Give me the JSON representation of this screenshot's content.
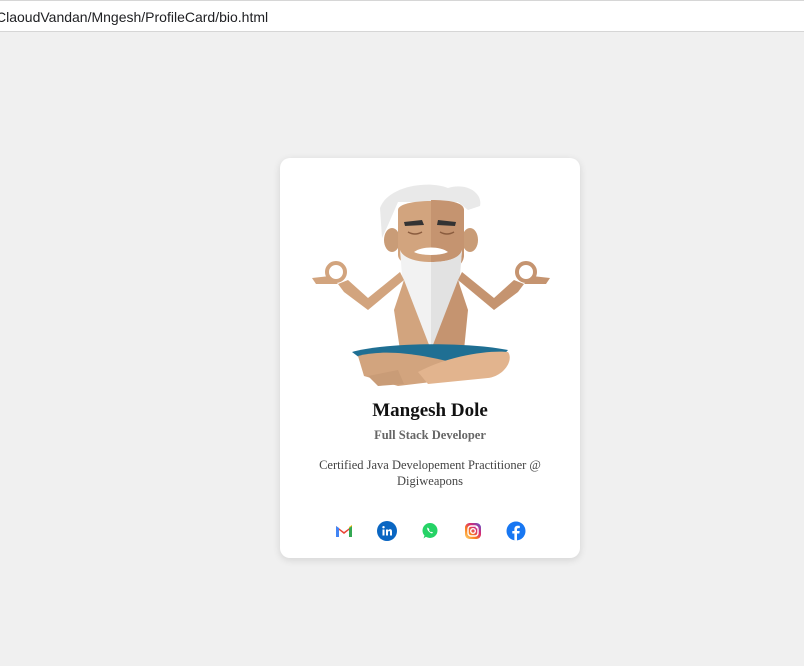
{
  "browser": {
    "address": "ClaoudVandan/Mngesh/ProfileCard/bio.html"
  },
  "profile": {
    "name": "Mangesh Dole",
    "role": "Full Stack Developer",
    "bio": "Certified Java Developement Practitioner @ Digiweapons",
    "avatar_icon": "meditating-monk-illustration"
  },
  "socials": [
    {
      "name": "gmail",
      "icon": "gmail-icon",
      "color": "#ea4335"
    },
    {
      "name": "linkedin",
      "icon": "linkedin-icon",
      "color": "#0a66c2"
    },
    {
      "name": "whatsapp",
      "icon": "whatsapp-icon",
      "color": "#25d366"
    },
    {
      "name": "instagram",
      "icon": "instagram-icon",
      "color": "#e1306c"
    },
    {
      "name": "facebook",
      "icon": "facebook-icon",
      "color": "#1877f2"
    }
  ],
  "colors": {
    "page_background": "#f0f0f0",
    "card_background": "#ffffff",
    "skin": "#d2a47e",
    "beard": "#e6e6e6",
    "lungi": "#1f6f93"
  }
}
